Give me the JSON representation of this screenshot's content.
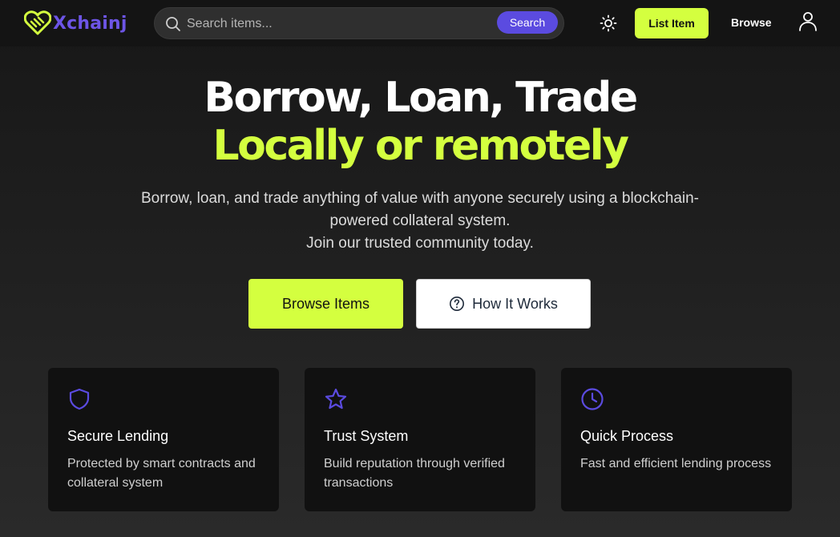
{
  "brand": {
    "name": "Xchainj",
    "accent": "#6d55e6",
    "lime": "#d4ff3f"
  },
  "search": {
    "placeholder": "Search items...",
    "button_label": "Search"
  },
  "nav": {
    "theme_icon": "sun-icon",
    "list_item_label": "List Item",
    "browse_label": "Browse",
    "user_icon": "user-icon"
  },
  "hero": {
    "line1": "Borrow, Loan, Trade",
    "line2": "Locally or remotely",
    "desc_line1": "Borrow, loan, and trade anything of value with anyone securely using a blockchain-powered collateral system.",
    "desc_line2": "Join our trusted community today.",
    "primary_label": "Browse Items",
    "secondary_label": "How It Works",
    "secondary_icon": "help-circle-icon"
  },
  "features": [
    {
      "icon": "shield-icon",
      "title": "Secure Lending",
      "desc": "Protected by smart contracts and collateral system"
    },
    {
      "icon": "star-icon",
      "title": "Trust System",
      "desc": "Build reputation through verified transactions"
    },
    {
      "icon": "clock-icon",
      "title": "Quick Process",
      "desc": "Fast and efficient lending process"
    }
  ]
}
